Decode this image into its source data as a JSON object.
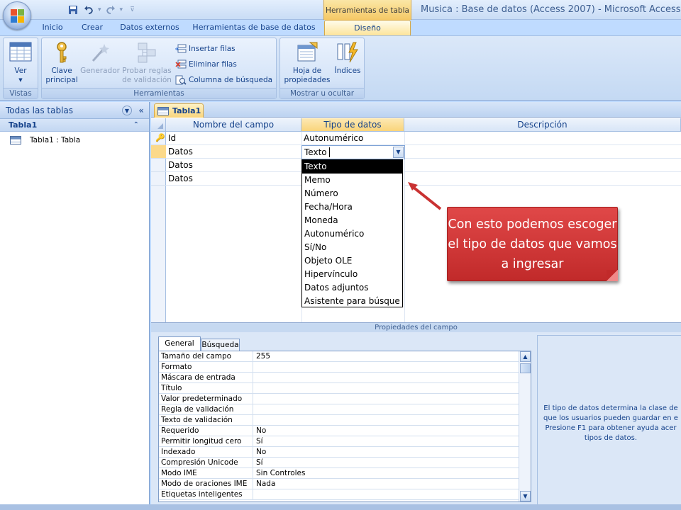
{
  "window": {
    "title": "Musica : Base de datos (Access 2007) - Microsoft Access",
    "contextual_group": "Herramientas de tabla"
  },
  "quick_access": [
    "save-icon",
    "undo-icon",
    "redo-icon",
    "customize-icon"
  ],
  "ribbon_tabs": [
    {
      "label": "Inicio"
    },
    {
      "label": "Crear"
    },
    {
      "label": "Datos externos"
    },
    {
      "label": "Herramientas de base de datos"
    },
    {
      "label": "Diseño",
      "active": true
    }
  ],
  "ribbon": {
    "groups": [
      {
        "label": "Vistas",
        "buttons": [
          {
            "label": "Ver",
            "icon": "datasheet-view-icon"
          }
        ]
      },
      {
        "label": "Herramientas",
        "buttons": [
          {
            "label": "Clave\nprincipal",
            "icon": "key-icon"
          },
          {
            "label": "Generador",
            "icon": "wand-icon",
            "disabled": true
          },
          {
            "label": "Probar reglas\nde validación",
            "icon": "validation-icon",
            "disabled": true
          }
        ],
        "small_buttons": [
          {
            "label": "Insertar filas",
            "icon": "insert-rows-icon"
          },
          {
            "label": "Eliminar filas",
            "icon": "delete-rows-icon"
          },
          {
            "label": "Columna de búsqueda",
            "icon": "lookup-column-icon"
          }
        ]
      },
      {
        "label": "Mostrar u ocultar",
        "buttons": [
          {
            "label": "Hoja de\npropiedades",
            "icon": "property-sheet-icon"
          },
          {
            "label": "Índices",
            "icon": "indexes-icon"
          }
        ]
      }
    ]
  },
  "nav": {
    "header": "Todas las tablas",
    "group": "Tabla1",
    "items": [
      {
        "label": "Tabla1 : Tabla",
        "icon": "table-icon"
      }
    ]
  },
  "document": {
    "tab": "Tabla1",
    "columns": [
      "Nombre del campo",
      "Tipo de datos",
      "Descripción"
    ],
    "rows": [
      {
        "name": "Id",
        "type": "Autonumérico",
        "primary_key": true
      },
      {
        "name": "Datos",
        "type": "Texto",
        "current": true
      },
      {
        "name": "Datos",
        "type": ""
      },
      {
        "name": "Datos",
        "type": ""
      }
    ],
    "type_dropdown": {
      "current_value": "Texto",
      "options": [
        "Texto",
        "Memo",
        "Número",
        "Fecha/Hora",
        "Moneda",
        "Autonumérico",
        "Sí/No",
        "Objeto OLE",
        "Hipervínculo",
        "Datos adjuntos",
        "Asistente para búsque"
      ],
      "selected_index": 0
    }
  },
  "callout": {
    "text": "Con esto podemos escoger el tipo de datos que vamos a ingresar",
    "color": "#c93232"
  },
  "field_properties": {
    "bar_label": "Propiedades del campo",
    "tabs": [
      "General",
      "Búsqueda"
    ],
    "active_tab": "General",
    "rows": [
      {
        "label": "Tamaño del campo",
        "value": "255"
      },
      {
        "label": "Formato",
        "value": ""
      },
      {
        "label": "Máscara de entrada",
        "value": ""
      },
      {
        "label": "Título",
        "value": ""
      },
      {
        "label": "Valor predeterminado",
        "value": ""
      },
      {
        "label": "Regla de validación",
        "value": ""
      },
      {
        "label": "Texto de validación",
        "value": ""
      },
      {
        "label": "Requerido",
        "value": "No"
      },
      {
        "label": "Permitir longitud cero",
        "value": "Sí"
      },
      {
        "label": "Indexado",
        "value": "No"
      },
      {
        "label": "Compresión Unicode",
        "value": "Sí"
      },
      {
        "label": "Modo IME",
        "value": "Sin Controles"
      },
      {
        "label": "Modo de oraciones IME",
        "value": "Nada"
      },
      {
        "label": "Etiquetas inteligentes",
        "value": ""
      }
    ],
    "help_lines": [
      "El tipo de datos determina la clase de",
      "que los usuarios pueden guardar en e",
      "Presione F1 para obtener ayuda acer",
      "tipos de datos."
    ]
  },
  "colors": {
    "ribbon_bg": "#c4d9f3",
    "active_tab": "#fde49a",
    "selection": "#000000",
    "accent_text": "#15428b"
  }
}
